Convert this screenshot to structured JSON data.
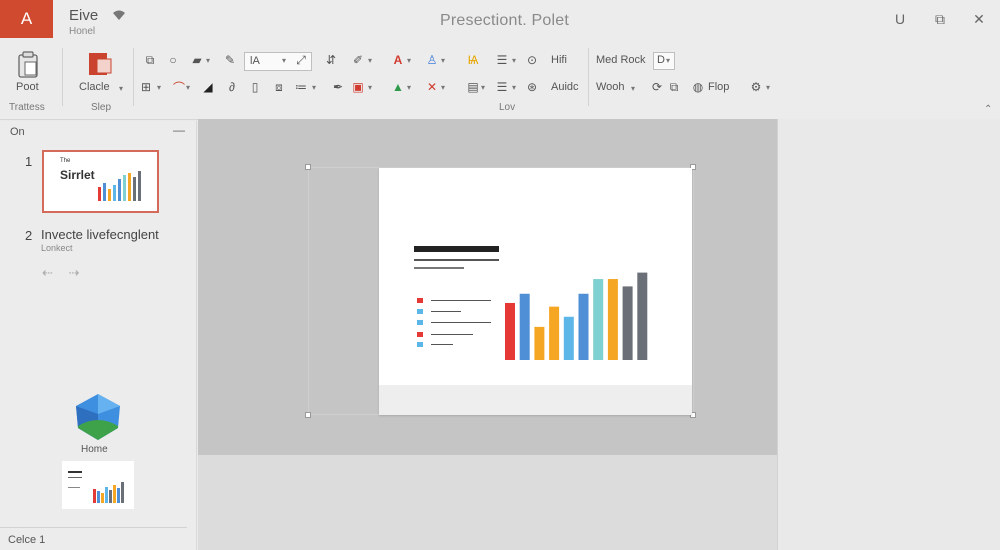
{
  "app": {
    "badge": "A",
    "file_name": "Eive",
    "file_sub": "Honel",
    "window_title": "Presectiont. Polet"
  },
  "window_controls": {
    "minimize": "U",
    "restore": "⧉",
    "close": "✕"
  },
  "ribbon": {
    "paste_label": "Poot",
    "new_slide_label": "Clacle",
    "group_left_label": "Trattess",
    "group_slide_label": "Slep",
    "group_main_label": "Lov",
    "font_combo_value": "lA",
    "hifi_label": "Hifi",
    "audio_label": "Auidc",
    "med_rock_label": "Med Rock",
    "med_rock_value": "D",
    "wooh_label": "Wooh",
    "flop_label": "Flop"
  },
  "colors": {
    "brand": "#d04a2f",
    "chart_red": "#e53935",
    "chart_blue": "#4f8fd6",
    "chart_orange": "#f5a623",
    "chart_lightblue": "#5db6e8",
    "chart_teal": "#7fd1d1",
    "chart_gray": "#6b6f78"
  },
  "left_panel": {
    "header": "On",
    "slides": [
      {
        "number": "1",
        "title": "Sirrlet",
        "small": "The"
      },
      {
        "number": "2",
        "title": "Invecte livefecnglent",
        "sub": "Lonkect"
      }
    ],
    "nav_arrows": "⇠ ⇢",
    "home_label": "Home",
    "status": "Celce 1"
  },
  "slide_bars": [
    0.62,
    0.72,
    0.36,
    0.58,
    0.47,
    0.72,
    0.88,
    0.88,
    0.8,
    0.95
  ]
}
